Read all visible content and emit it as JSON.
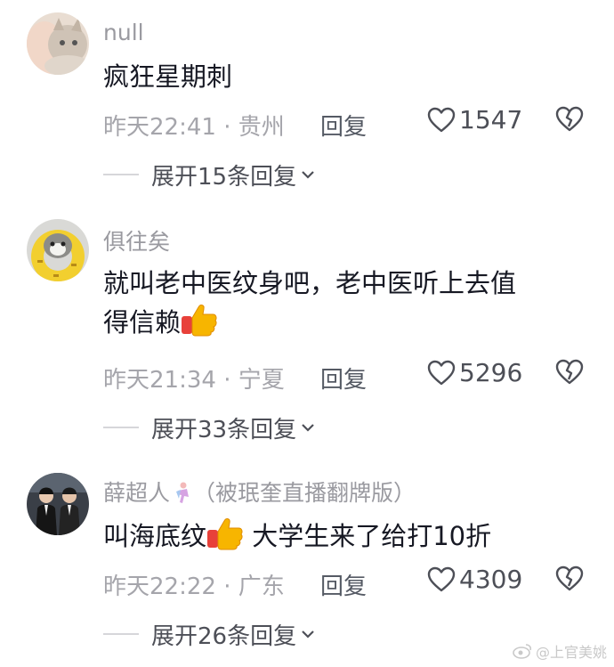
{
  "comments": [
    {
      "username": "null",
      "text": "疯狂星期刺",
      "time_location": "昨天22:41 · 贵州",
      "reply_label": "回复",
      "likes": "1547",
      "expand_label": "展开15条回复"
    },
    {
      "username": "俱往矣",
      "text_line1": "就叫老中医纹身吧，老中医听上去值",
      "text_line2": "得信赖",
      "time_location": "昨天21:34 · 宁夏",
      "reply_label": "回复",
      "likes": "5296",
      "expand_label": "展开33条回复"
    },
    {
      "username": "薛超人",
      "username_suffix": "（被珉奎直播翻牌版）",
      "text_part1": "叫海底纹",
      "text_part2": " 大学生来了给打10折",
      "time_location": "昨天22:22 · 广东",
      "reply_label": "回复",
      "likes": "4309",
      "expand_label": "展开26条回复"
    }
  ],
  "icons": {
    "like": "heart-icon",
    "dislike": "broken-heart-icon",
    "expand": "chevron-down-icon",
    "emoji": "thumbs-up-emoji"
  },
  "watermark": "@上官美姚"
}
